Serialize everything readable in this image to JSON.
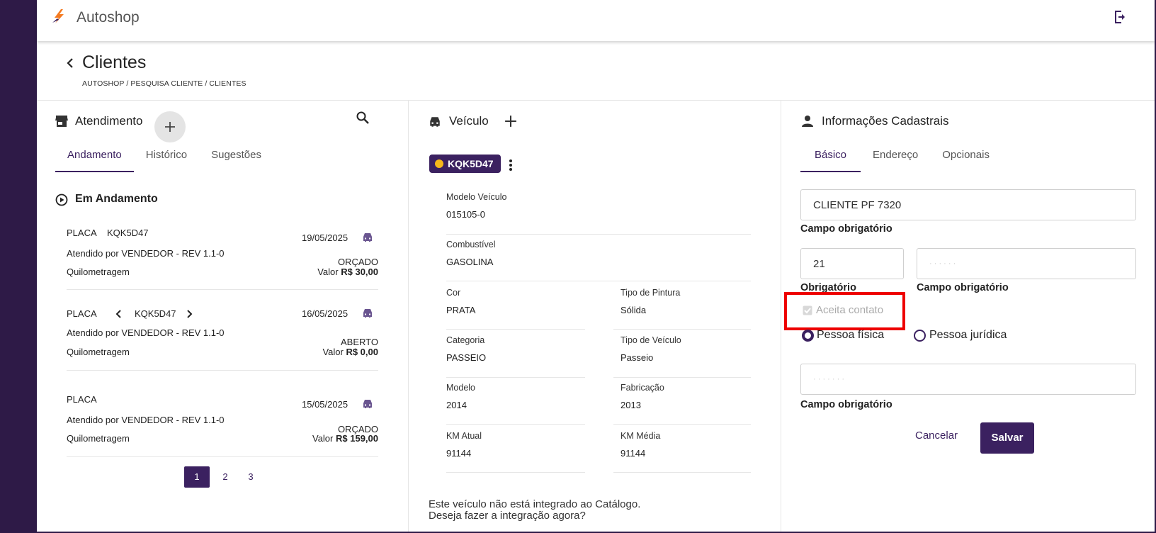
{
  "app": {
    "title": "Autoshop"
  },
  "page": {
    "title": "Clientes",
    "breadcrumb": "AUTOSHOP / PESQUISA CLIENTE / CLIENTES"
  },
  "atendimento": {
    "title": "Atendimento",
    "tabs": [
      "Andamento",
      "Histórico",
      "Sugestões"
    ],
    "section_title": "Em Andamento",
    "items": [
      {
        "placa_label": "PLACA",
        "placa": "KQK5D47",
        "date": "19/05/2025",
        "atendido": "Atendido por VENDEDOR - REV 1.1-0",
        "status": "ORÇADO",
        "km_label": "Quilometragem",
        "valor_label": "Valor",
        "valor": "R$ 30,00"
      },
      {
        "placa_label": "PLACA",
        "placa": "KQK5D47",
        "date": "16/05/2025",
        "atendido": "Atendido por VENDEDOR - REV 1.1-0",
        "status": "ABERTO",
        "km_label": "Quilometragem",
        "valor_label": "Valor",
        "valor": "R$ 0,00"
      },
      {
        "placa_label": "PLACA",
        "placa": "",
        "date": "15/05/2025",
        "atendido": "Atendido por VENDEDOR - REV 1.1-0",
        "status": "ORÇADO",
        "km_label": "Quilometragem",
        "valor_label": "Valor",
        "valor": "R$ 159,00"
      }
    ],
    "pages": [
      "1",
      "2",
      "3"
    ]
  },
  "veiculo": {
    "title": "Veículo",
    "plate": "KQK5D47",
    "fields": [
      {
        "label": "Modelo Veículo",
        "value": "015105-0"
      },
      {
        "label": "Combustível",
        "value": "GASOLINA"
      },
      {
        "label": "Cor",
        "value": "PRATA"
      },
      {
        "label": "Tipo de Pintura",
        "value": "Sólida"
      },
      {
        "label": "Categoria",
        "value": "PASSEIO"
      },
      {
        "label": "Tipo de Veículo",
        "value": "Passeio"
      },
      {
        "label": "Modelo",
        "value": "2014"
      },
      {
        "label": "Fabricação",
        "value": "2013"
      },
      {
        "label": "KM Atual",
        "value": "91144"
      },
      {
        "label": "KM Média",
        "value": "91144"
      }
    ],
    "message_line1": "Este veículo não está integrado ao Catálogo.",
    "message_line2": "Deseja fazer a integração agora?"
  },
  "cadastro": {
    "title": "Informações Cadastrais",
    "tabs": [
      "Básico",
      "Endereço",
      "Opcionais"
    ],
    "name_value": "CLIENTE PF 7320",
    "name_hint": "Campo obrigatório",
    "ddd_value": "21",
    "ddd_hint": "Obrigatório",
    "phone_hint": "Campo obrigatório",
    "aceita_contato": "Aceita contato",
    "pessoa_fisica": "Pessoa física",
    "pessoa_juridica": "Pessoa jurídica",
    "doc_hint": "Campo obrigatório",
    "cancel_label": "Cancelar",
    "save_label": "Salvar"
  },
  "colors": {
    "primary": "#3b2160",
    "sidebar": "#2e1a47",
    "plate_dot": "#f6b81a",
    "highlight": "#ee0000"
  }
}
